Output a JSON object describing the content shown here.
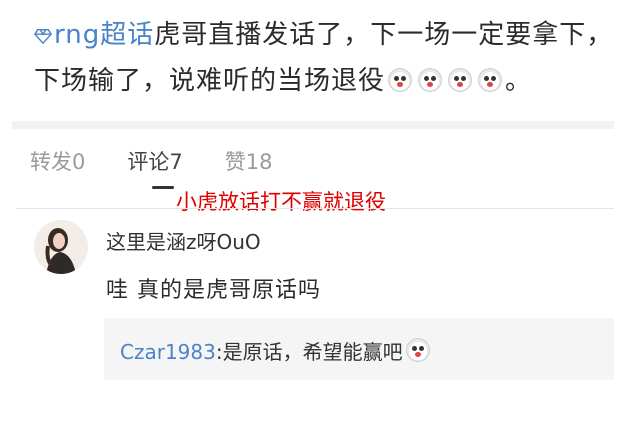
{
  "post": {
    "topic": "rng超话",
    "text": "虎哥直播发话了，下一场一定要拿下，下场输了，说难听的当场退役",
    "ending": "。",
    "emoji_icon": "scared-face-emoji"
  },
  "tabs": [
    {
      "label": "转发0"
    },
    {
      "label": "评论7"
    },
    {
      "label": "赞18"
    }
  ],
  "annotation": "小虎放话打不赢就退役",
  "comment": {
    "username": "这里是涵z呀OuO",
    "body": "哇 真的是虎哥原话吗",
    "reply": {
      "username": "Czar1983",
      "text": ":是原话，希望能赢吧"
    }
  },
  "colors": {
    "topic_blue": "#4a83c8",
    "annotation_red": "#e00000"
  }
}
